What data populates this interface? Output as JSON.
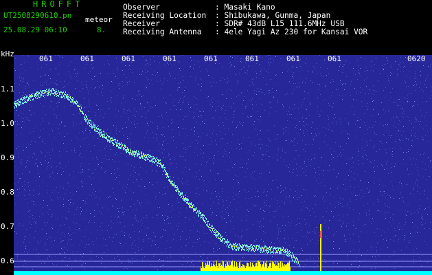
{
  "header": {
    "title": "HROFFT",
    "file_name": "UT2508290610.pn",
    "meteor_label": "meteor",
    "date_time": "25.08.29 06:10",
    "count": "8.",
    "info_rows": [
      {
        "label": "Observer",
        "value": ": Masaki Kano"
      },
      {
        "label": "Receiving Location",
        "value": ": Shibukawa, Gunma, Japan"
      },
      {
        "label": "Receiver",
        "value": ": SDR# 43dB L15 111.6MHz USB"
      },
      {
        "label": "Receiving Antenna",
        "value": ": 4ele Yagi Az 230 for Kansai VOR"
      }
    ]
  },
  "spectrogram": {
    "unit_label": "kHz",
    "y_ticks": [
      "1.1",
      "1.0",
      "0.9",
      "0.8",
      "0.7",
      "0.6"
    ],
    "x_ticks": [
      "061",
      "061",
      "061",
      "061",
      "061",
      "061",
      "061",
      "061",
      "0620"
    ],
    "colors": {
      "background": "#27279a",
      "trace": "#7ff2e6",
      "meteor_echo": "#ffff00",
      "baseline": "#00ffff",
      "text_green": "#1fd000",
      "text_white": "#ffffff"
    }
  }
}
